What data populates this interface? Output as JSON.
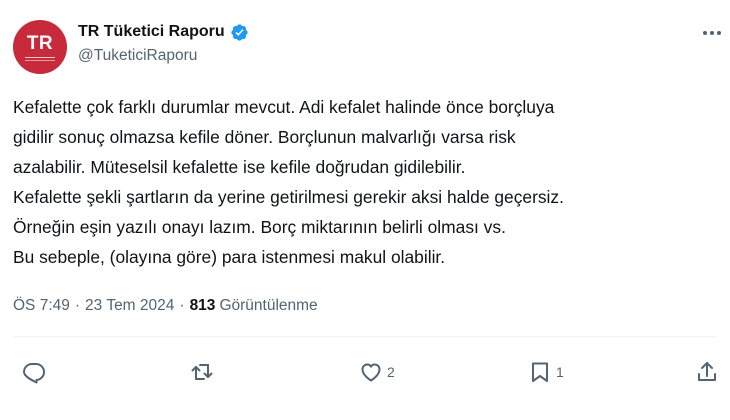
{
  "user": {
    "avatar_text": "TR",
    "display_name": "TR Tüketici Raporu",
    "handle": "@TuketiciRaporu",
    "verified": true
  },
  "tweet": {
    "lines": [
      "Kefalette çok farklı durumlar mevcut. Adi kefalet halinde önce borçluya",
      "gidilir sonuç olmazsa kefile döner. Borçlunun malvarlığı varsa risk",
      "azalabilir. Müteselsil kefalette ise kefile doğrudan gidilebilir.",
      "Kefalette şekli şartların da yerine getirilmesi gerekir aksi halde geçersiz.",
      "Örneğin eşin yazılı onayı lazım. Borç miktarının belirli olması vs.",
      "Bu sebeple, (olayına göre) para istenmesi makul olabilir."
    ]
  },
  "meta": {
    "time": "ÖS 7:49",
    "separator": "·",
    "date": "23 Tem 2024",
    "views_count": "813",
    "views_label": "Görüntülenme"
  },
  "actions": {
    "reply_count": "",
    "retweet_count": "",
    "like_count": "2",
    "bookmark_count": "1"
  },
  "colors": {
    "avatar_bg": "#c72a3b",
    "verified": "#1d9bf0",
    "secondary_text": "#536471",
    "icons": "#536471"
  },
  "icons": [
    "verified-badge-icon",
    "more-icon",
    "reply-icon",
    "retweet-icon",
    "like-icon",
    "bookmark-icon",
    "share-icon"
  ]
}
